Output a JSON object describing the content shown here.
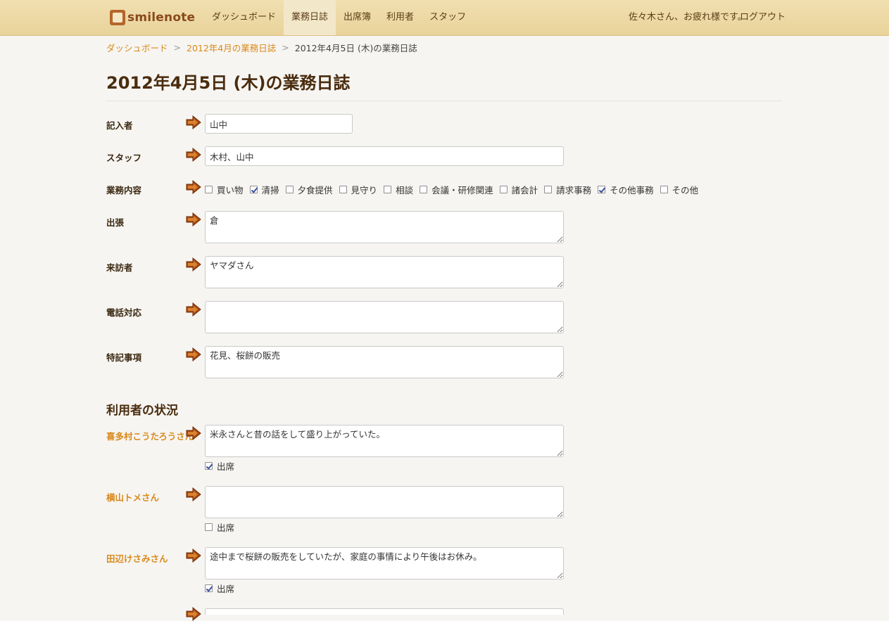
{
  "header": {
    "logo_text": "smilenote",
    "nav": [
      "ダッシュボード",
      "業務日誌",
      "出席簿",
      "利用者",
      "スタッフ"
    ],
    "active_nav": "業務日誌",
    "greeting": "佐々木さん、お疲れ様です。",
    "logout": "ログアウト"
  },
  "breadcrumb": {
    "home": "ダッシュボード",
    "month": "2012年4月の業務日誌",
    "current": "2012年4月5日 (木)の業務日誌",
    "separator": ">"
  },
  "page_title": "2012年4月5日 (木)の業務日誌",
  "form": {
    "author_label": "記入者",
    "author_value": "山中",
    "staff_label": "スタッフ",
    "staff_value": "木村、山中",
    "tasks_label": "業務内容",
    "tasks": [
      {
        "label": "買い物",
        "checked": false
      },
      {
        "label": "清掃",
        "checked": true
      },
      {
        "label": "夕食提供",
        "checked": false
      },
      {
        "label": "見守り",
        "checked": false
      },
      {
        "label": "相談",
        "checked": false
      },
      {
        "label": "会議・研修関連",
        "checked": false
      },
      {
        "label": "諸会計",
        "checked": false
      },
      {
        "label": "請求事務",
        "checked": false
      },
      {
        "label": "その他事務",
        "checked": true
      },
      {
        "label": "その他",
        "checked": false
      }
    ],
    "trip_label": "出張",
    "trip_value": "倉",
    "visitor_label": "来訪者",
    "visitor_value": "ヤマダさん",
    "phone_label": "電話対応",
    "phone_value": "",
    "notes_label": "特記事項",
    "notes_value": "花見、桜餅の販売"
  },
  "users_section": {
    "title": "利用者の状況",
    "attendance_label": "出席",
    "users": [
      {
        "name": "喜多村こうたろうさん",
        "note": "米永さんと昔の話をして盛り上がっていた。",
        "attended": true
      },
      {
        "name": "横山トメさん",
        "note": "",
        "attended": false
      },
      {
        "name": "田辺けさみさん",
        "note": "途中まで桜餅の販売をしていたが、家庭の事情により午後はお休み。",
        "attended": true
      }
    ]
  },
  "colors": {
    "header_bg": "#ecd8a4",
    "accent_orange": "#d9891a",
    "title_brown": "#4a2c0e",
    "arrow_brown": "#a84a12"
  }
}
